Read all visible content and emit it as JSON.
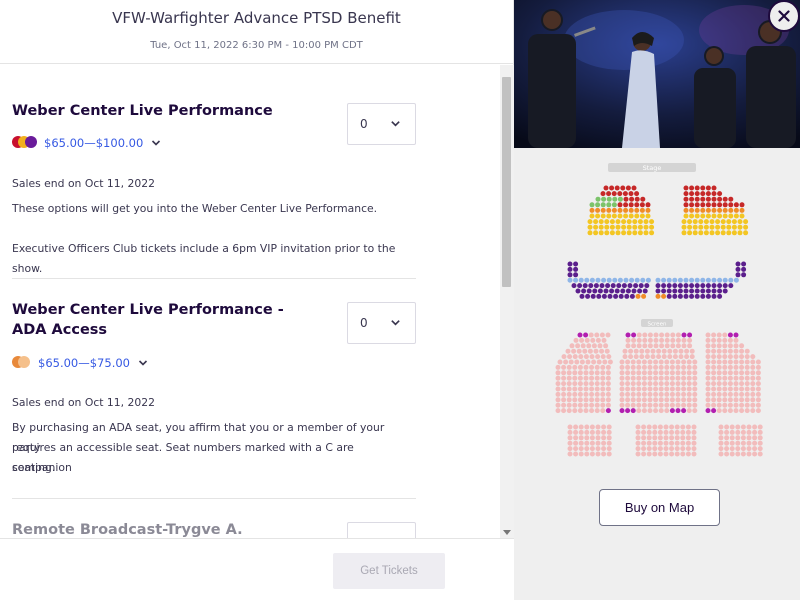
{
  "event": {
    "title": "VFW-Warfighter Advance PTSD Benefit",
    "date": "Tue, Oct 11, 2022 6:30 PM - 10:00 PM CDT"
  },
  "tickets": [
    {
      "name": "Weber Center Live Performance",
      "quantity": "0",
      "price": "$65.00—$100.00",
      "sales_end": "Sales end on Oct 11, 2022",
      "description": "These options will get you into the Weber Center Live Performance.",
      "note": "Executive Officers Club tickets include a 6pm VIP invitation prior to the show.",
      "dot_colors": [
        "#c8102e",
        "#f2b01e",
        "#6a1b9a"
      ]
    },
    {
      "name_line1": "Weber Center Live Performance -",
      "name_line2": "ADA Access",
      "quantity": "0",
      "price": "$65.00—$75.00",
      "sales_end": "Sales end on Oct 11, 2022",
      "description_line1": "By purchasing an ADA seat, you affirm that you or a member of your party",
      "description_line2": "requires an accessible seat. Seat numbers marked with a C are companion",
      "description_line3": "seating.",
      "dot_colors": [
        "#e8893a",
        "#f5c08b"
      ]
    },
    {
      "name": "Remote Broadcast-Trygve A."
    }
  ],
  "footer": {
    "get_tickets": "Get Tickets"
  },
  "map": {
    "stage_label": "Stage",
    "screen_label": "Screen",
    "buy_on_map": "Buy on Map"
  },
  "colors": {
    "link": "#3659e3",
    "heading": "#1e0a3c",
    "seat_red": "#c62828",
    "seat_green": "#7cc36a",
    "seat_yellow": "#f3c623",
    "seat_orange": "#f08c28",
    "seat_purple": "#5b1f8c",
    "seat_blue": "#8fb6e8",
    "seat_pink": "#f2bcbc",
    "seat_magenta": "#b21fb0"
  },
  "icons": {
    "close": "close-icon",
    "chevron": "chevron-down-icon"
  }
}
